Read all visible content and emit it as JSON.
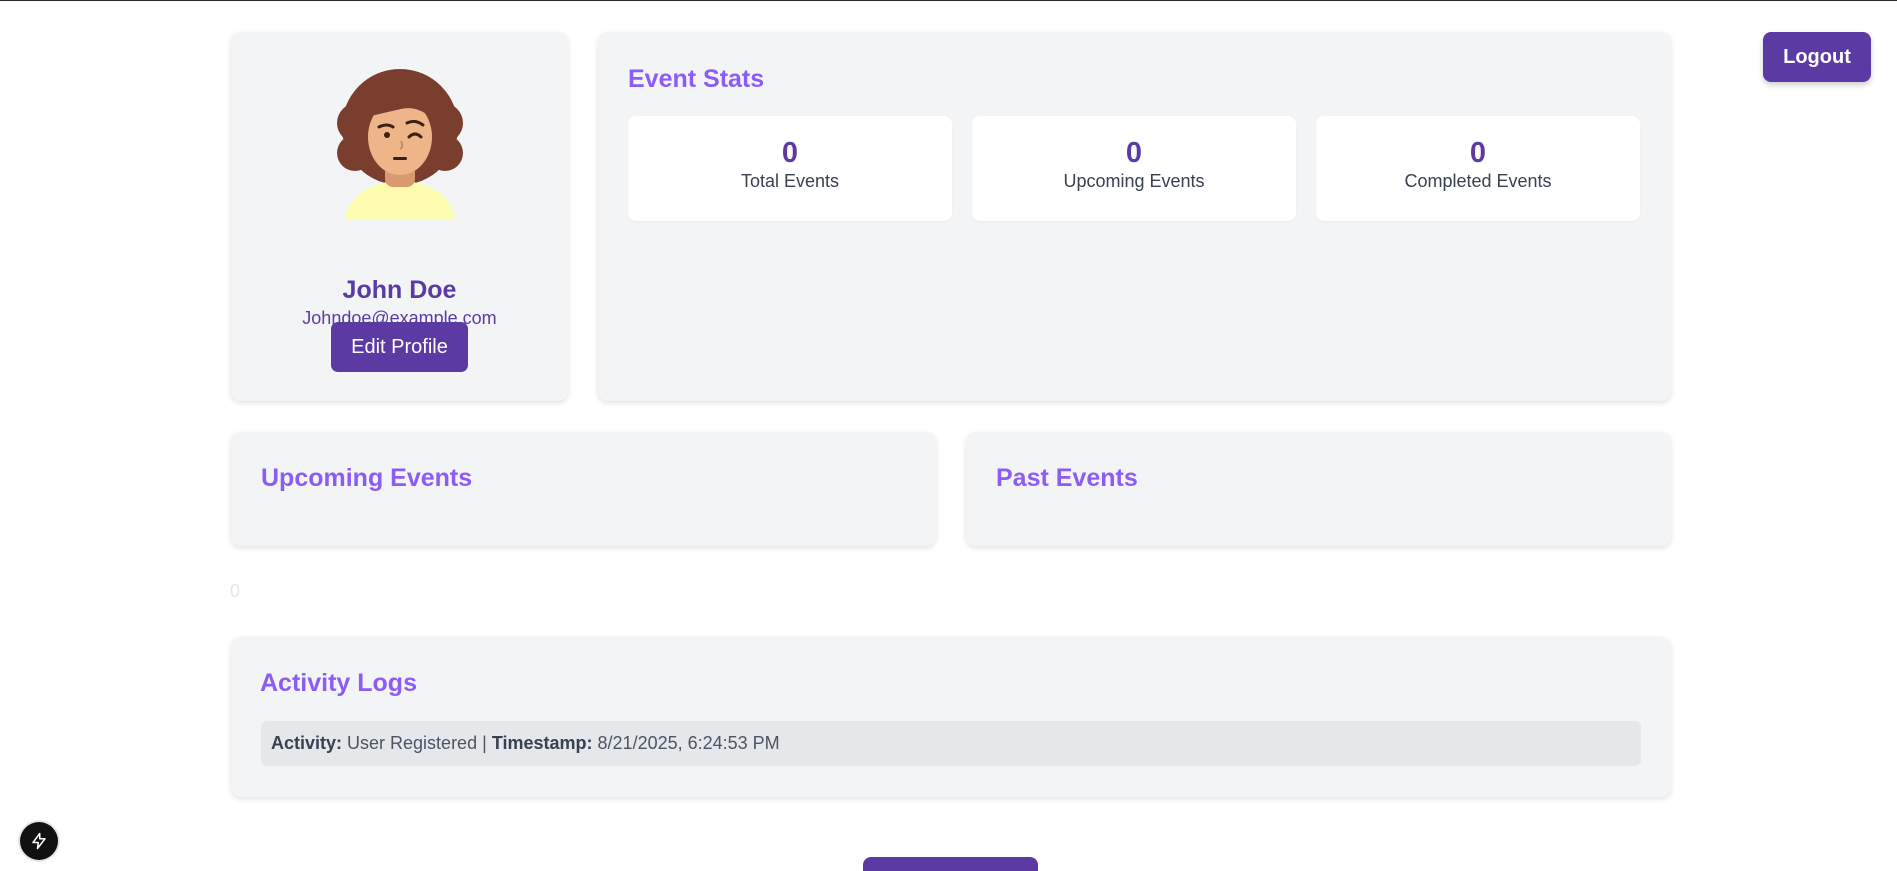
{
  "profile": {
    "name": "John Doe",
    "email": "Johndoe@example.com",
    "edit_label": "Edit Profile",
    "avatar_icon": "avatar-woman-winking"
  },
  "stats": {
    "title": "Event Stats",
    "items": [
      {
        "value": "0",
        "label": "Total Events"
      },
      {
        "value": "0",
        "label": "Upcoming Events"
      },
      {
        "value": "0",
        "label": "Completed Events"
      }
    ]
  },
  "upcoming": {
    "title": "Upcoming Events"
  },
  "past": {
    "title": "Past Events"
  },
  "stray_count": "0",
  "activity": {
    "title": "Activity Logs",
    "logs": [
      {
        "activity_key": "Activity:",
        "activity_value": "User Registered",
        "separator": "|",
        "timestamp_key": "Timestamp:",
        "timestamp_value": "8/21/2025, 6:24:53 PM"
      }
    ]
  },
  "header": {
    "logout_label": "Logout"
  },
  "dev_indicator_icon": "lightning-icon",
  "colors": {
    "primary": "#5b3aa3",
    "accent": "#8b5cf6",
    "card_bg": "#f3f4f6"
  }
}
